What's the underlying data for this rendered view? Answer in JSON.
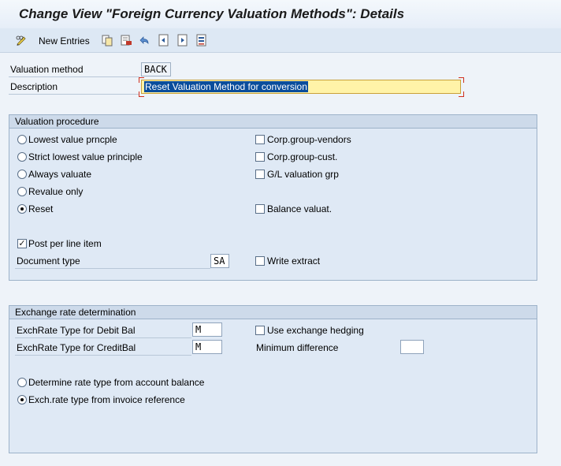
{
  "title": "Change View \"Foreign Currency Valuation Methods\": Details",
  "toolbar": {
    "new_entries_label": "New Entries",
    "icons": [
      "pencil-glasses-icon",
      "copy-icon",
      "delete-icon",
      "undo-icon",
      "previous-entry-icon",
      "next-entry-icon",
      "select-all-icon"
    ]
  },
  "header": {
    "valuation_method_label": "Valuation method",
    "valuation_method_value": "BACK",
    "description_label": "Description",
    "description_value": "Reset Valuation Method for conversion"
  },
  "valuation_procedure": {
    "title": "Valuation procedure",
    "radios": [
      {
        "label": "Lowest value prncple",
        "selected": false
      },
      {
        "label": "Strict lowest value principle",
        "selected": false
      },
      {
        "label": "Always valuate",
        "selected": false
      },
      {
        "label": "Revalue only",
        "selected": false
      },
      {
        "label": "Reset",
        "selected": true
      }
    ],
    "checks": [
      {
        "label": "Corp.group-vendors",
        "checked": false
      },
      {
        "label": "Corp.group-cust.",
        "checked": false
      },
      {
        "label": "G/L valuation grp",
        "checked": false
      },
      {
        "label": "Balance valuat.",
        "checked": false
      }
    ],
    "post_per_line_item": {
      "label": "Post per line item",
      "checked": true
    },
    "document_type_label": "Document type",
    "document_type_value": "SA",
    "write_extract": {
      "label": "Write extract",
      "checked": false
    }
  },
  "exchange_rate": {
    "title": "Exchange rate determination",
    "debit_label": "ExchRate Type for Debit Bal",
    "debit_value": "M",
    "credit_label": "ExchRate Type for CreditBal",
    "credit_value": "M",
    "use_hedging": {
      "label": "Use exchange hedging",
      "checked": false
    },
    "min_diff_label": "Minimum difference",
    "min_diff_value": "",
    "radios": [
      {
        "label": "Determine rate type from account balance",
        "selected": false
      },
      {
        "label": "Exch.rate type from invoice reference",
        "selected": true
      }
    ]
  },
  "colors": {
    "background": "#dfe9f5",
    "focus_field": "#fff3a8",
    "selection": "#0a4d9c"
  }
}
